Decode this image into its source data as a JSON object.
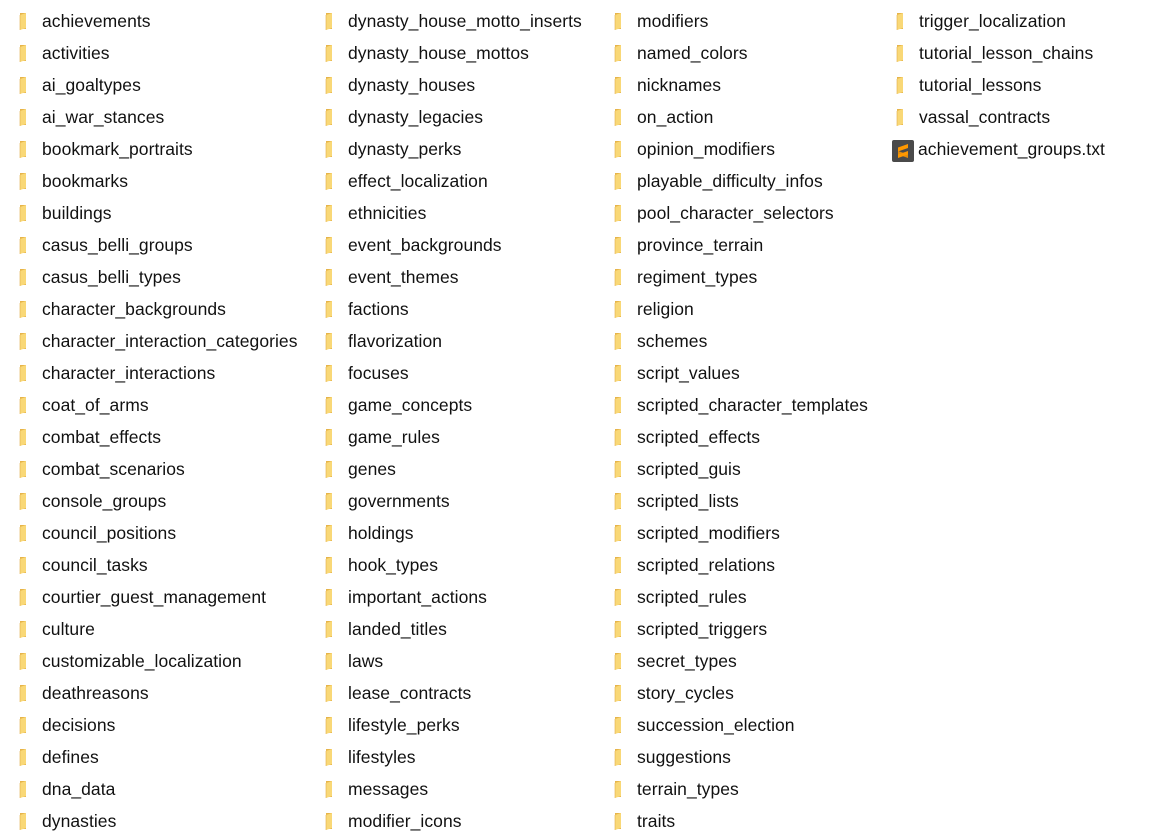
{
  "view": "file-explorer-list",
  "columns": [
    {
      "items": [
        {
          "name": "achievements",
          "type": "folder",
          "icon": "folder-icon"
        },
        {
          "name": "activities",
          "type": "folder",
          "icon": "folder-icon"
        },
        {
          "name": "ai_goaltypes",
          "type": "folder",
          "icon": "folder-icon"
        },
        {
          "name": "ai_war_stances",
          "type": "folder",
          "icon": "folder-icon"
        },
        {
          "name": "bookmark_portraits",
          "type": "folder",
          "icon": "folder-icon"
        },
        {
          "name": "bookmarks",
          "type": "folder",
          "icon": "folder-icon"
        },
        {
          "name": "buildings",
          "type": "folder",
          "icon": "folder-icon"
        },
        {
          "name": "casus_belli_groups",
          "type": "folder",
          "icon": "folder-icon"
        },
        {
          "name": "casus_belli_types",
          "type": "folder",
          "icon": "folder-icon"
        },
        {
          "name": "character_backgrounds",
          "type": "folder",
          "icon": "folder-icon"
        },
        {
          "name": "character_interaction_categories",
          "type": "folder",
          "icon": "folder-icon"
        },
        {
          "name": "character_interactions",
          "type": "folder",
          "icon": "folder-icon"
        },
        {
          "name": "coat_of_arms",
          "type": "folder",
          "icon": "folder-icon"
        },
        {
          "name": "combat_effects",
          "type": "folder",
          "icon": "folder-icon"
        },
        {
          "name": "combat_scenarios",
          "type": "folder",
          "icon": "folder-icon"
        },
        {
          "name": "console_groups",
          "type": "folder",
          "icon": "folder-icon"
        },
        {
          "name": "council_positions",
          "type": "folder",
          "icon": "folder-icon"
        },
        {
          "name": "council_tasks",
          "type": "folder",
          "icon": "folder-icon"
        },
        {
          "name": "courtier_guest_management",
          "type": "folder",
          "icon": "folder-icon"
        },
        {
          "name": "culture",
          "type": "folder",
          "icon": "folder-icon"
        },
        {
          "name": "customizable_localization",
          "type": "folder",
          "icon": "folder-icon"
        },
        {
          "name": "deathreasons",
          "type": "folder",
          "icon": "folder-icon"
        },
        {
          "name": "decisions",
          "type": "folder",
          "icon": "folder-icon"
        },
        {
          "name": "defines",
          "type": "folder",
          "icon": "folder-icon"
        },
        {
          "name": "dna_data",
          "type": "folder",
          "icon": "folder-icon"
        },
        {
          "name": "dynasties",
          "type": "folder",
          "icon": "folder-icon"
        }
      ]
    },
    {
      "items": [
        {
          "name": "dynasty_house_motto_inserts",
          "type": "folder",
          "icon": "folder-icon"
        },
        {
          "name": "dynasty_house_mottos",
          "type": "folder",
          "icon": "folder-icon"
        },
        {
          "name": "dynasty_houses",
          "type": "folder",
          "icon": "folder-icon"
        },
        {
          "name": "dynasty_legacies",
          "type": "folder",
          "icon": "folder-icon"
        },
        {
          "name": "dynasty_perks",
          "type": "folder",
          "icon": "folder-icon"
        },
        {
          "name": "effect_localization",
          "type": "folder",
          "icon": "folder-icon"
        },
        {
          "name": "ethnicities",
          "type": "folder",
          "icon": "folder-icon"
        },
        {
          "name": "event_backgrounds",
          "type": "folder",
          "icon": "folder-icon"
        },
        {
          "name": "event_themes",
          "type": "folder",
          "icon": "folder-icon"
        },
        {
          "name": "factions",
          "type": "folder",
          "icon": "folder-icon"
        },
        {
          "name": "flavorization",
          "type": "folder",
          "icon": "folder-icon"
        },
        {
          "name": "focuses",
          "type": "folder",
          "icon": "folder-icon"
        },
        {
          "name": "game_concepts",
          "type": "folder",
          "icon": "folder-icon"
        },
        {
          "name": "game_rules",
          "type": "folder",
          "icon": "folder-icon"
        },
        {
          "name": "genes",
          "type": "folder",
          "icon": "folder-icon"
        },
        {
          "name": "governments",
          "type": "folder",
          "icon": "folder-icon"
        },
        {
          "name": "holdings",
          "type": "folder",
          "icon": "folder-icon"
        },
        {
          "name": "hook_types",
          "type": "folder",
          "icon": "folder-icon"
        },
        {
          "name": "important_actions",
          "type": "folder",
          "icon": "folder-icon"
        },
        {
          "name": "landed_titles",
          "type": "folder",
          "icon": "folder-icon"
        },
        {
          "name": "laws",
          "type": "folder",
          "icon": "folder-icon"
        },
        {
          "name": "lease_contracts",
          "type": "folder",
          "icon": "folder-icon"
        },
        {
          "name": "lifestyle_perks",
          "type": "folder",
          "icon": "folder-icon"
        },
        {
          "name": "lifestyles",
          "type": "folder",
          "icon": "folder-icon"
        },
        {
          "name": "messages",
          "type": "folder",
          "icon": "folder-icon"
        },
        {
          "name": "modifier_icons",
          "type": "folder",
          "icon": "folder-icon"
        }
      ]
    },
    {
      "items": [
        {
          "name": "modifiers",
          "type": "folder",
          "icon": "folder-icon"
        },
        {
          "name": "named_colors",
          "type": "folder",
          "icon": "folder-icon"
        },
        {
          "name": "nicknames",
          "type": "folder",
          "icon": "folder-icon"
        },
        {
          "name": "on_action",
          "type": "folder",
          "icon": "folder-icon"
        },
        {
          "name": "opinion_modifiers",
          "type": "folder",
          "icon": "folder-icon"
        },
        {
          "name": "playable_difficulty_infos",
          "type": "folder",
          "icon": "folder-icon"
        },
        {
          "name": "pool_character_selectors",
          "type": "folder",
          "icon": "folder-icon"
        },
        {
          "name": "province_terrain",
          "type": "folder",
          "icon": "folder-icon"
        },
        {
          "name": "regiment_types",
          "type": "folder",
          "icon": "folder-icon"
        },
        {
          "name": "religion",
          "type": "folder",
          "icon": "folder-icon"
        },
        {
          "name": "schemes",
          "type": "folder",
          "icon": "folder-icon"
        },
        {
          "name": "script_values",
          "type": "folder",
          "icon": "folder-icon"
        },
        {
          "name": "scripted_character_templates",
          "type": "folder",
          "icon": "folder-icon"
        },
        {
          "name": "scripted_effects",
          "type": "folder",
          "icon": "folder-icon"
        },
        {
          "name": "scripted_guis",
          "type": "folder",
          "icon": "folder-icon"
        },
        {
          "name": "scripted_lists",
          "type": "folder",
          "icon": "folder-icon"
        },
        {
          "name": "scripted_modifiers",
          "type": "folder",
          "icon": "folder-icon"
        },
        {
          "name": "scripted_relations",
          "type": "folder",
          "icon": "folder-icon"
        },
        {
          "name": "scripted_rules",
          "type": "folder",
          "icon": "folder-icon"
        },
        {
          "name": "scripted_triggers",
          "type": "folder",
          "icon": "folder-icon"
        },
        {
          "name": "secret_types",
          "type": "folder",
          "icon": "folder-icon"
        },
        {
          "name": "story_cycles",
          "type": "folder",
          "icon": "folder-icon"
        },
        {
          "name": "succession_election",
          "type": "folder",
          "icon": "folder-icon"
        },
        {
          "name": "suggestions",
          "type": "folder",
          "icon": "folder-icon"
        },
        {
          "name": "terrain_types",
          "type": "folder",
          "icon": "folder-icon"
        },
        {
          "name": "traits",
          "type": "folder",
          "icon": "folder-icon"
        }
      ]
    },
    {
      "items": [
        {
          "name": "trigger_localization",
          "type": "folder",
          "icon": "folder-icon"
        },
        {
          "name": "tutorial_lesson_chains",
          "type": "folder",
          "icon": "folder-icon"
        },
        {
          "name": "tutorial_lessons",
          "type": "folder",
          "icon": "folder-icon"
        },
        {
          "name": "vassal_contracts",
          "type": "folder",
          "icon": "folder-icon"
        },
        {
          "name": "achievement_groups.txt",
          "type": "file",
          "icon": "sublime-text-file-icon"
        }
      ]
    }
  ],
  "colors": {
    "folder_front": "#f9d877",
    "folder_back": "#e6b44a",
    "sublime_bg": "#4a4a4a",
    "sublime_accent": "#ff9800"
  }
}
